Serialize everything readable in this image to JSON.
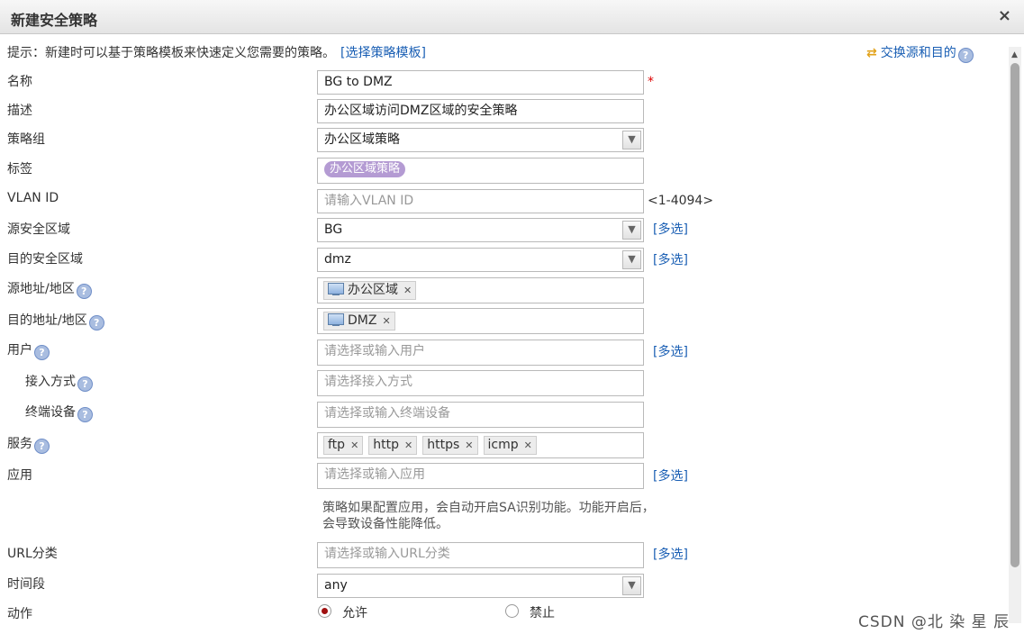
{
  "dialog": {
    "title": "新建安全策略",
    "close": "×"
  },
  "hint": {
    "text": "提示：新建时可以基于策略模板来快速定义您需要的策略。",
    "link": "[选择策略模板]"
  },
  "swap": {
    "label": "交换源和目的",
    "icon": "swap-arrows-icon"
  },
  "form": {
    "name": {
      "label": "名称",
      "value": "BG to DMZ",
      "required_mark": "*"
    },
    "desc": {
      "label": "描述",
      "value": "办公区域访问DMZ区域的安全策略"
    },
    "group": {
      "label": "策略组",
      "value": "办公区域策略"
    },
    "tag": {
      "label": "标签",
      "chip": "办公区域策略",
      "chip_color": "#b49bd3"
    },
    "vlan": {
      "label": "VLAN ID",
      "placeholder": "请输入VLAN ID",
      "range": "<1-4094>"
    },
    "src_zone": {
      "label": "源安全区域",
      "value": "BG",
      "multi": "[多选]"
    },
    "dst_zone": {
      "label": "目的安全区域",
      "value": "dmz",
      "multi": "[多选]"
    },
    "src_addr": {
      "label": "源地址/地区",
      "chip": "办公区域"
    },
    "dst_addr": {
      "label": "目的地址/地区",
      "chip": "DMZ"
    },
    "user": {
      "label": "用户",
      "placeholder": "请选择或输入用户",
      "multi": "[多选]"
    },
    "access": {
      "label": "接入方式",
      "placeholder": "请选择接入方式"
    },
    "terminal": {
      "label": "终端设备",
      "placeholder": "请选择或输入终端设备"
    },
    "service": {
      "label": "服务",
      "chips": [
        "ftp",
        "http",
        "https",
        "icmp"
      ]
    },
    "app": {
      "label": "应用",
      "placeholder": "请选择或输入应用",
      "multi": "[多选]",
      "note": "策略如果配置应用，会自动开启SA识别功能。功能开启后，会导致设备性能降低。"
    },
    "url": {
      "label": "URL分类",
      "placeholder": "请选择或输入URL分类",
      "multi": "[多选]"
    },
    "time": {
      "label": "时间段",
      "value": "any"
    },
    "action": {
      "label": "动作",
      "options": [
        "允许",
        "禁止"
      ],
      "selected": "允许"
    }
  },
  "help_glyph": "?",
  "dropdown_glyph": "▼",
  "remove_glyph": "✕",
  "watermark": "CSDN @北 染 星 辰",
  "colors": {
    "accent": "#1a5fb4",
    "required": "#d00000",
    "radio_selected": "#a01010"
  }
}
